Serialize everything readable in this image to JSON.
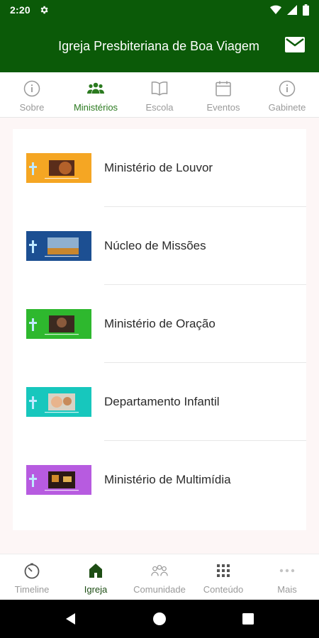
{
  "status_bar": {
    "time": "2:20"
  },
  "app_bar": {
    "title": "Igreja Presbiteriana de Boa Viagem"
  },
  "top_tabs": [
    {
      "label": "Sobre",
      "icon": "info-icon",
      "active": false
    },
    {
      "label": "Ministérios",
      "icon": "people-icon",
      "active": true
    },
    {
      "label": "Escola",
      "icon": "book-icon",
      "active": false
    },
    {
      "label": "Eventos",
      "icon": "calendar-icon",
      "active": false
    },
    {
      "label": "Gabinete",
      "icon": "info-icon",
      "active": false
    }
  ],
  "ministries": [
    {
      "name": "Ministério de Louvor",
      "color": "#f5a623"
    },
    {
      "name": "Núcleo de Missões",
      "color": "#1c4f92"
    },
    {
      "name": "Ministério de Oração",
      "color": "#2eb82e"
    },
    {
      "name": "Departamento Infantil",
      "color": "#17c7bd"
    },
    {
      "name": "Ministério de Multimídia",
      "color": "#b75be0"
    }
  ],
  "bottom_nav": [
    {
      "label": "Timeline",
      "icon": "timer-icon",
      "active": false
    },
    {
      "label": "Igreja",
      "icon": "church-icon",
      "active": true
    },
    {
      "label": "Comunidade",
      "icon": "community-icon",
      "active": false
    },
    {
      "label": "Conteúdo",
      "icon": "grid-icon",
      "active": false
    },
    {
      "label": "Mais",
      "icon": "more-icon",
      "active": false
    }
  ],
  "colors": {
    "brand_green": "#0b5a08",
    "active_tab": "#2b7a1f",
    "inactive": "#9a9a9a"
  }
}
